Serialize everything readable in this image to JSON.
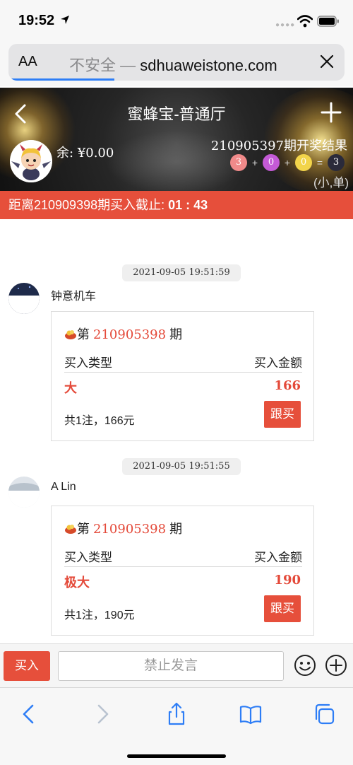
{
  "status_bar": {
    "time": "19:52"
  },
  "browser": {
    "aa_label": "AA",
    "insecure_label": "不安全 —",
    "domain": "sdhuaweistone.com"
  },
  "header": {
    "title": "蜜蜂宝-普通厅",
    "balance": "余: ¥0.00",
    "result_title": "210905397期开奖结果",
    "balls": [
      "3",
      "0",
      "0",
      "3"
    ],
    "ops": [
      "+",
      "+",
      "="
    ],
    "ball_colors": [
      "#f08a8a",
      "#c45ad6",
      "#f2d44a",
      "#2a2a3a"
    ],
    "sum_label": "(小,单)"
  },
  "countdown": {
    "label": "距离210909398期买入截止: ",
    "timer": "01 : 43"
  },
  "messages": [
    {
      "time": "2021-09-05 19:51:59",
      "name": "钟意机车",
      "period_prefix": "第",
      "period": "210905398",
      "period_suffix": "期",
      "col_type": "买入类型",
      "col_amount": "买入金额",
      "bet_type": "大",
      "amount": "166",
      "summary": "共1注，166元",
      "follow": "跟买"
    },
    {
      "time": "2021-09-05 19:51:55",
      "name": "A Lin",
      "period_prefix": "第",
      "period": "210905398",
      "period_suffix": "期",
      "col_type": "买入类型",
      "col_amount": "买入金额",
      "bet_type": "极大",
      "amount": "190",
      "summary": "共1注，190元",
      "follow": "跟买"
    }
  ],
  "input_bar": {
    "buy": "买入",
    "placeholder": "禁止发言"
  },
  "colors": {
    "accent": "#e64f3b",
    "number": "#e44a3a"
  }
}
